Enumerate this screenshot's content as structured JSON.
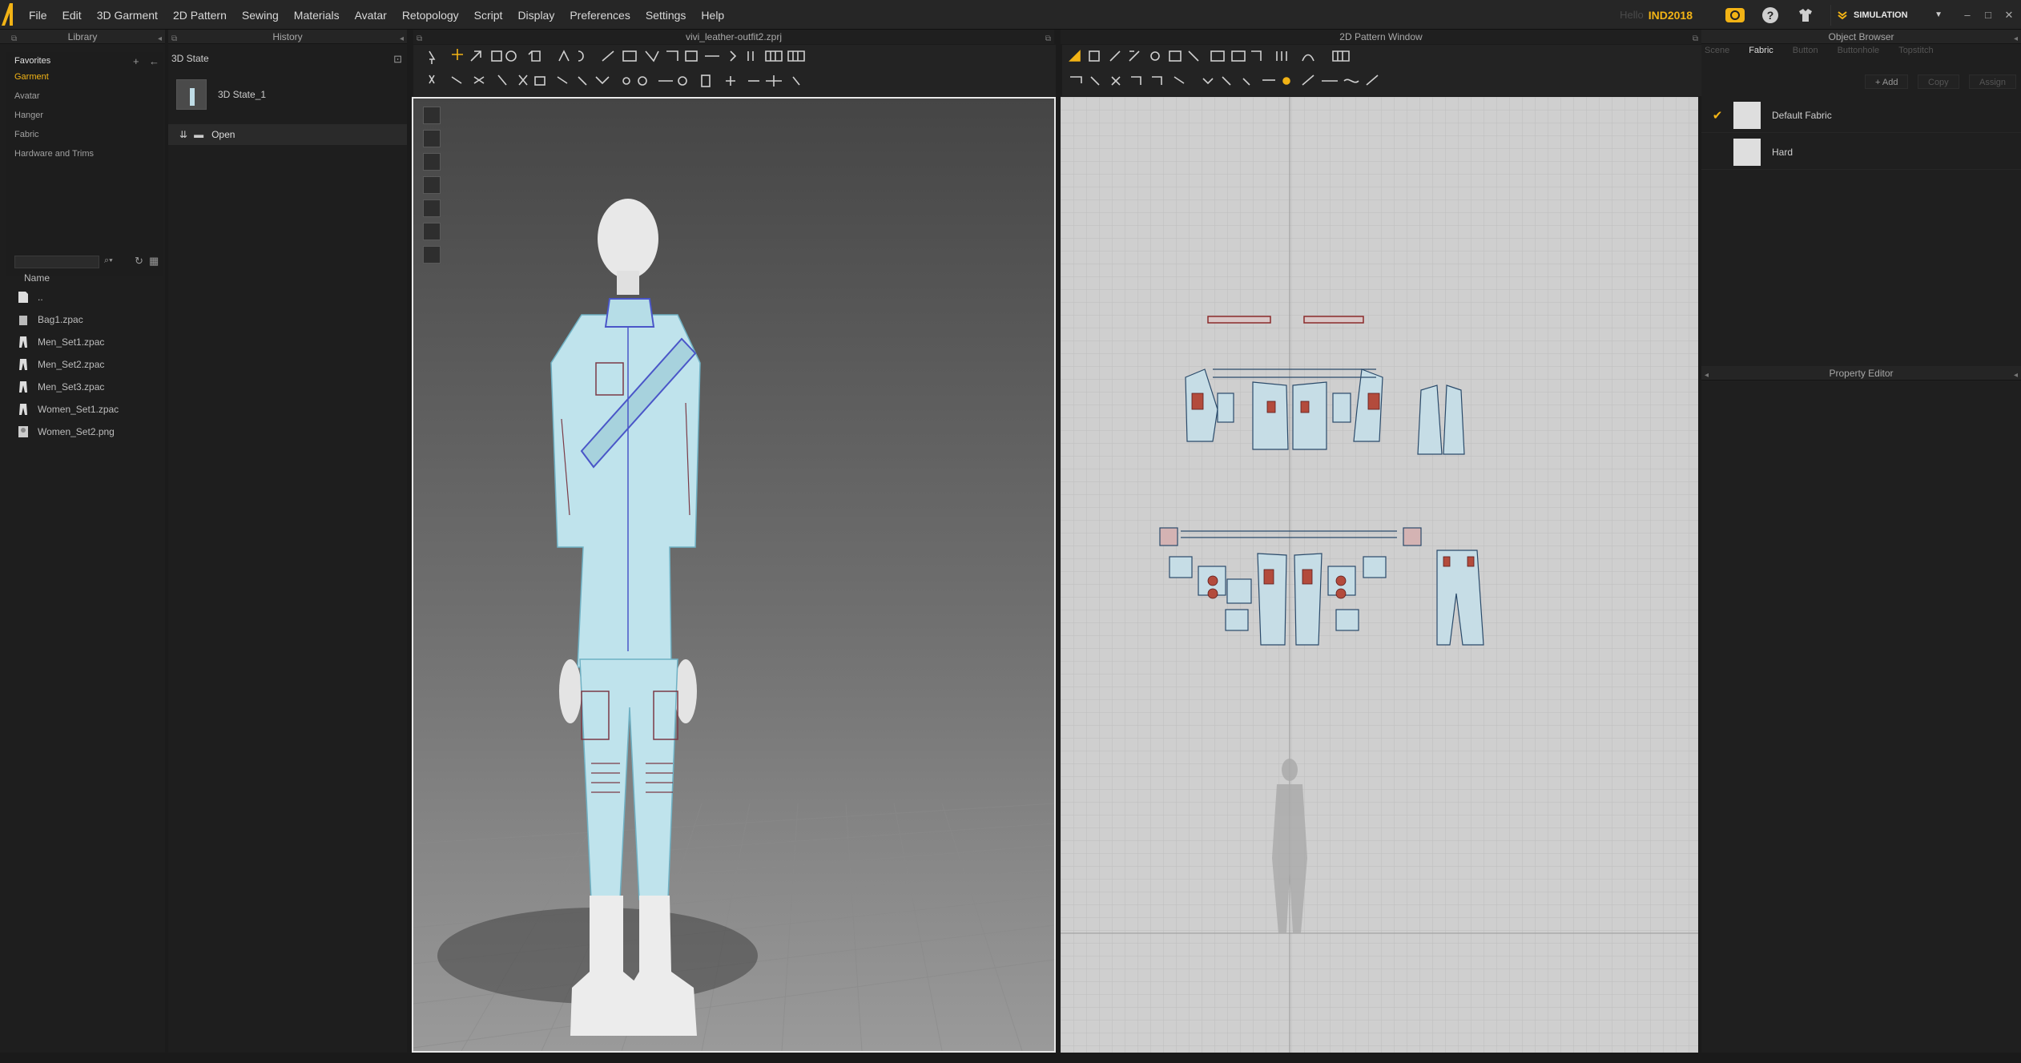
{
  "menubar": {
    "items": [
      "File",
      "Edit",
      "3D Garment",
      "2D Pattern",
      "Sewing",
      "Materials",
      "Avatar",
      "Retopology",
      "Script",
      "Display",
      "Preferences",
      "Settings",
      "Help"
    ],
    "greeting": "Hello",
    "user": "IND2018",
    "mode": "SIMULATION",
    "accent": "#f2b315"
  },
  "library": {
    "title": "Library",
    "favorites_title": "Favorites",
    "favorites": [
      "Garment",
      "Avatar",
      "Hanger",
      "Fabric",
      "Hardware and Trims"
    ],
    "active_favorite": "Garment",
    "name_header": "Name",
    "files": [
      {
        "name": "..",
        "icon": "folder-up-icon"
      },
      {
        "name": "Bag1.zpac",
        "icon": "bag-icon"
      },
      {
        "name": "Men_Set1.zpac",
        "icon": "garment-icon"
      },
      {
        "name": "Men_Set2.zpac",
        "icon": "garment-icon"
      },
      {
        "name": "Men_Set3.zpac",
        "icon": "garment-icon"
      },
      {
        "name": "Women_Set1.zpac",
        "icon": "garment-icon"
      },
      {
        "name": "Women_Set2.png",
        "icon": "image-icon"
      }
    ]
  },
  "history": {
    "title": "History",
    "state_title": "3D State",
    "state_item": "3D State_1",
    "open_item": "Open"
  },
  "viewport3d": {
    "title": "vivi_leather-outfit2.zprj"
  },
  "pattern2d": {
    "title": "2D Pattern Window"
  },
  "object_browser": {
    "title": "Object Browser",
    "tabs": [
      "Scene",
      "Fabric",
      "Button",
      "Buttonhole",
      "Topstitch"
    ],
    "active_tab": "Fabric",
    "buttons": [
      "+ Add",
      "Copy",
      "Assign"
    ],
    "fabrics": [
      {
        "name": "Default Fabric",
        "checked": true
      },
      {
        "name": "Hard",
        "checked": false
      }
    ]
  },
  "property_editor": {
    "title": "Property Editor"
  }
}
